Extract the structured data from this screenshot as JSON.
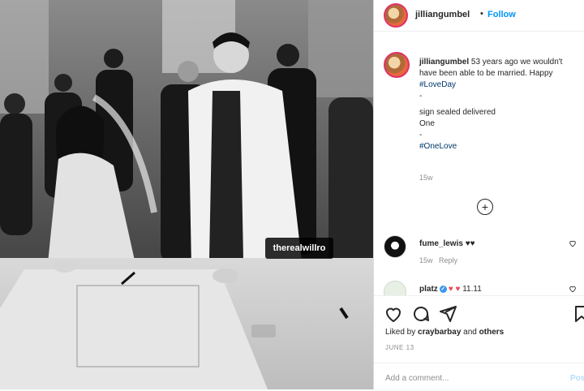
{
  "post": {
    "username": "jilliangumbel",
    "separator": "•",
    "follow_label": "Follow",
    "photo_tag": "therealwillro"
  },
  "caption": {
    "username": "jilliangumbel",
    "line1": "53 years ago we wouldn't have been able to be married. Happy ",
    "hashtag1": "#LoveDay",
    "dash1": "-",
    "line2": "sign sealed delivered",
    "line3": "One",
    "dash2": "-",
    "hashtag2": "#OneLove",
    "time": "15w"
  },
  "more_comments_icon": "plus-circle-icon",
  "comments": [
    {
      "username": "fume_lewis",
      "text": "♥♥",
      "time": "15w",
      "reply_label": "Reply",
      "like_icon": "heart-outline-icon"
    },
    {
      "username": "platz",
      "verified_mark": "✓",
      "hearts": "♥ ♥",
      "text": "11.11",
      "like_icon": "heart-outline-icon"
    }
  ],
  "actions": {
    "like_icon": "heart-icon",
    "comment_icon": "comment-icon",
    "share_icon": "share-icon",
    "save_icon": "bookmark-icon",
    "likes_prefix": "Liked by ",
    "likes_user": "craybarbay",
    "likes_and": " and ",
    "likes_others": "others",
    "date": "JUNE 13"
  },
  "add_comment": {
    "placeholder": "Add a comment...",
    "post_label": "Post"
  },
  "colors": {
    "accent": "#0095f6",
    "heart": "#ed4956",
    "muted": "#8e8e8e"
  }
}
